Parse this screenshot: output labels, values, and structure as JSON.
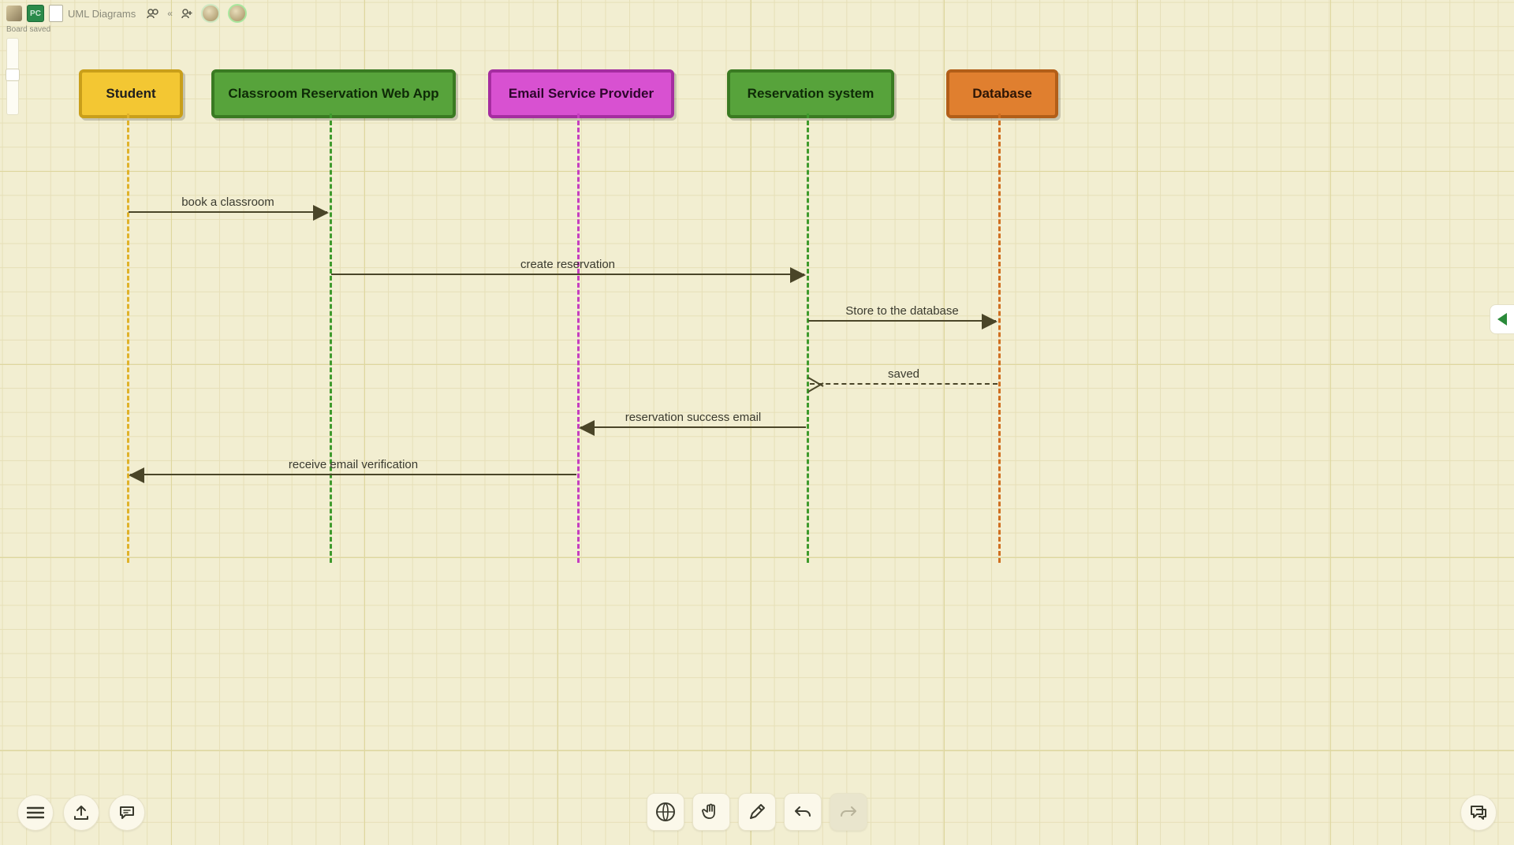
{
  "header": {
    "title": "UML Diagrams",
    "avatar_initials": "PC",
    "status": "Board saved"
  },
  "lifelines": {
    "student": "Student",
    "webapp": "Classroom Reservation Web App",
    "email_provider": "Email Service Provider",
    "reservation_system": "Reservation system",
    "database": "Database"
  },
  "messages": {
    "m1": "book a classroom",
    "m2": "create reservation",
    "m3": "Store to the database",
    "m4": "saved",
    "m5": "reservation success email",
    "m6": "receive email verification"
  },
  "chart_data": {
    "type": "sequence-diagram",
    "participants": [
      {
        "id": "student",
        "label": "Student",
        "color": "yellow"
      },
      {
        "id": "webapp",
        "label": "Classroom Reservation Web App",
        "color": "green"
      },
      {
        "id": "email_provider",
        "label": "Email Service Provider",
        "color": "pink"
      },
      {
        "id": "reservation_system",
        "label": "Reservation system",
        "color": "green"
      },
      {
        "id": "database",
        "label": "Database",
        "color": "orange"
      }
    ],
    "messages": [
      {
        "from": "student",
        "to": "webapp",
        "label": "book a classroom",
        "style": "solid"
      },
      {
        "from": "webapp",
        "to": "reservation_system",
        "label": "create reservation",
        "style": "solid"
      },
      {
        "from": "reservation_system",
        "to": "database",
        "label": "Store to the database",
        "style": "solid"
      },
      {
        "from": "database",
        "to": "reservation_system",
        "label": "saved",
        "style": "dashed-return"
      },
      {
        "from": "reservation_system",
        "to": "email_provider",
        "label": "reservation success email",
        "style": "solid"
      },
      {
        "from": "email_provider",
        "to": "student",
        "label": "receive email verification",
        "style": "solid"
      }
    ]
  }
}
